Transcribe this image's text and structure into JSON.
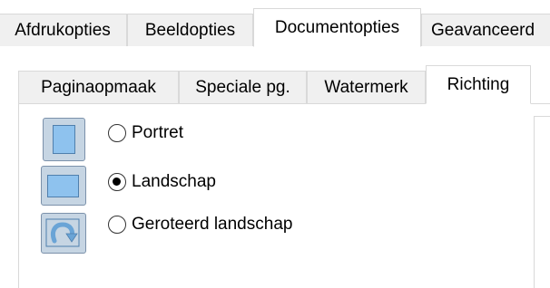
{
  "top_tabs": [
    {
      "label": "Afdrukopties"
    },
    {
      "label": "Beeldopties"
    },
    {
      "label": "Documentopties",
      "active": true
    },
    {
      "label": "Geavanceerd"
    }
  ],
  "sub_tabs": [
    {
      "label": "Paginaopmaak"
    },
    {
      "label": "Speciale pg."
    },
    {
      "label": "Watermerk"
    },
    {
      "label": "Richting",
      "active": true
    }
  ],
  "orientation": {
    "options": [
      {
        "label": "Portret",
        "icon": "portrait-page-icon",
        "checked": false
      },
      {
        "label": "Landschap",
        "icon": "landscape-page-icon",
        "checked": true
      },
      {
        "label": "Geroteerd landschap",
        "icon": "rotated-landscape-icon",
        "checked": false
      }
    ]
  },
  "colors": {
    "tab_border": "#d9d9d9",
    "tab_inactive_bg": "#f0f0f0",
    "icon_fill": "#8ec2ee"
  }
}
